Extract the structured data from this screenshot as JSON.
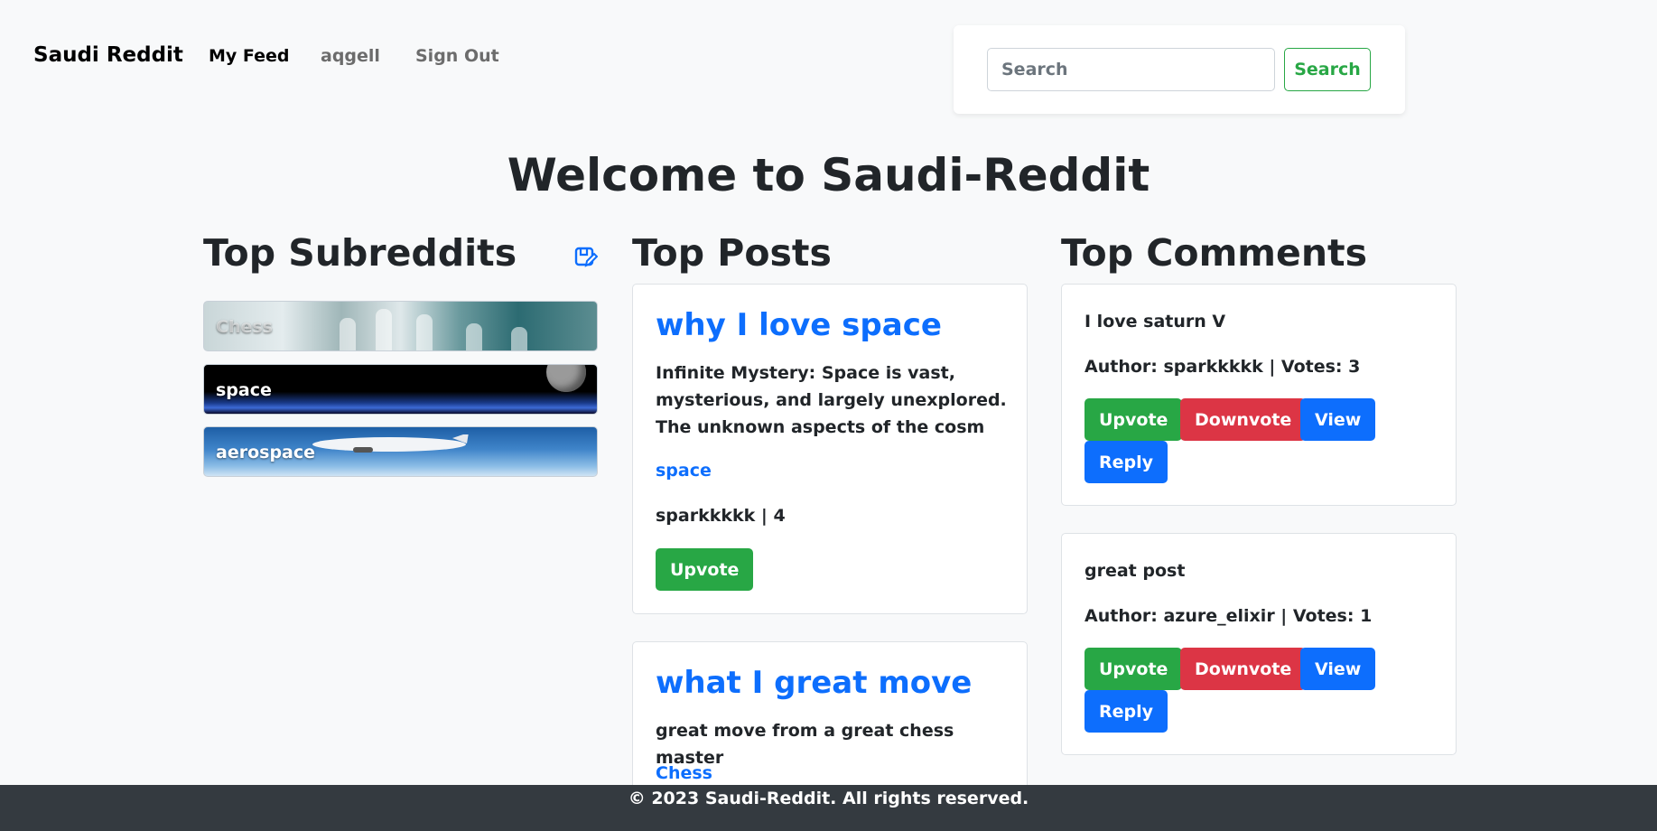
{
  "nav": {
    "brand": "Saudi Reddit",
    "feed": "My Feed",
    "user": "aqgell",
    "signout": "Sign Out"
  },
  "search": {
    "placeholder": "Search",
    "button": "Search"
  },
  "page_title": "Welcome to Saudi-Reddit",
  "columns": {
    "subreddits": "Top Subreddits",
    "posts": "Top Posts",
    "comments": "Top Comments"
  },
  "subreddits": [
    {
      "label": "Chess"
    },
    {
      "label": "space"
    },
    {
      "label": "aerospace"
    }
  ],
  "posts": [
    {
      "title": "why I love space",
      "body": "Infinite Mystery: Space is vast, mysterious, and largely unexplored. The unknown aspects of the cosm",
      "subreddit": "space",
      "meta": "sparkkkkk | 4",
      "upvote": "Upvote"
    },
    {
      "title": "what I great move",
      "body": "great move from a great chess master",
      "subreddit": "Chess"
    }
  ],
  "comments": [
    {
      "text": "I love saturn V",
      "meta": "Author: sparkkkkk | Votes: 3",
      "upvote": "Upvote",
      "downvote": "Downvote",
      "view": "View",
      "reply": "Reply"
    },
    {
      "text": "great post",
      "meta": "Author: azure_elixir | Votes: 1",
      "upvote": "Upvote",
      "downvote": "Downvote",
      "view": "View",
      "reply": "Reply"
    }
  ],
  "footer": "© 2023 Saudi-Reddit. All rights reserved.",
  "colors": {
    "primary": "#0d6efd",
    "success": "#28a745",
    "danger": "#dc3545",
    "footer_bg": "#343a40",
    "page_bg": "#f8f9fa"
  },
  "icons": {
    "edit": "edit-icon"
  }
}
